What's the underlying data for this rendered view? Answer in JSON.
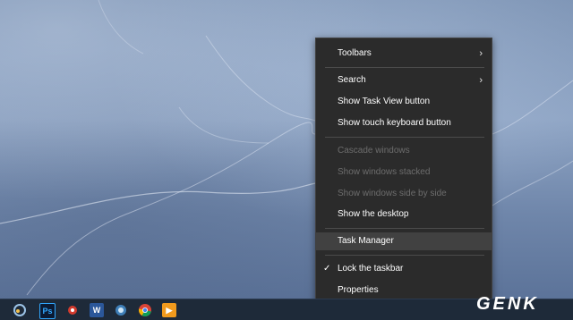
{
  "context_menu": {
    "items": [
      {
        "label": "Toolbars",
        "submenu": true,
        "enabled": true
      },
      {
        "label": "Search",
        "submenu": true,
        "enabled": true
      },
      {
        "label": "Show Task View button",
        "enabled": true
      },
      {
        "label": "Show touch keyboard button",
        "enabled": true
      },
      {
        "label": "Cascade windows",
        "enabled": false
      },
      {
        "label": "Show windows stacked",
        "enabled": false
      },
      {
        "label": "Show windows side by side",
        "enabled": false
      },
      {
        "label": "Show the desktop",
        "enabled": true
      },
      {
        "label": "Task Manager",
        "enabled": true,
        "highlighted": true
      },
      {
        "label": "Lock the taskbar",
        "enabled": true,
        "checked": true
      },
      {
        "label": "Properties",
        "enabled": true
      }
    ],
    "submenu_glyph": "›",
    "check_glyph": "✓"
  },
  "taskbar": {
    "apps": [
      {
        "name": "start-icon",
        "glyph": ""
      },
      {
        "name": "photoshop-icon",
        "glyph": "Ps"
      },
      {
        "name": "app-icon",
        "glyph": ""
      },
      {
        "name": "word-icon",
        "glyph": "W"
      },
      {
        "name": "app-icon",
        "glyph": ""
      },
      {
        "name": "chrome-icon",
        "glyph": ""
      },
      {
        "name": "media-player-icon",
        "glyph": "▶"
      }
    ]
  },
  "watermark": {
    "text": "GENK"
  },
  "colors": {
    "menu_bg": "#2b2b2b",
    "menu_text": "#ffffff",
    "menu_disabled": "#6d6d6d",
    "menu_highlight": "#414141",
    "taskbar_bg": "#1e2a39"
  }
}
